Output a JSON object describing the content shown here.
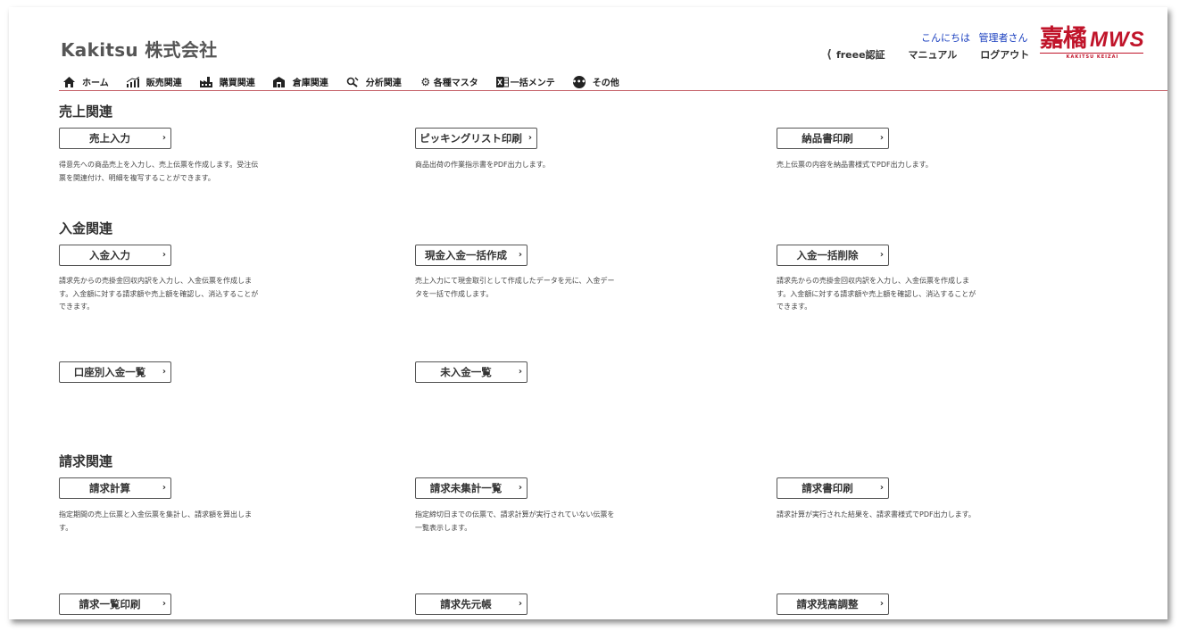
{
  "header": {
    "company": "Kakitsu 株式会社",
    "greeting_prefix": "こんにちは",
    "user_name": "管理者さん",
    "links": {
      "freee": "freee認証",
      "manual": "マニュアル",
      "logout": "ログアウト"
    },
    "logo": {
      "kanji": "嘉橘",
      "mws": "MWS",
      "sub": "KAKITSU KEIZAI"
    }
  },
  "nav": {
    "home": "ホーム",
    "sales": "販売関連",
    "purchase": "購買関連",
    "warehouse": "倉庫関連",
    "analysis": "分析関連",
    "master": "各種マスタ",
    "bulk": "一括メンテ",
    "other": "その他"
  },
  "sections": {
    "sales": {
      "title": "売上関連",
      "b1": {
        "label": "売上入力",
        "desc": "得意先への商品売上を入力し、売上伝票を作成します。受注伝票を関連付け、明細を複写することができます。"
      },
      "b2": {
        "label": "ピッキングリスト印刷",
        "desc": "商品出荷の作業指示書をPDF出力します。"
      },
      "b3": {
        "label": "納品書印刷",
        "desc": "売上伝票の内容を納品書様式でPDF出力します。"
      }
    },
    "payment": {
      "title": "入金関連",
      "b1": {
        "label": "入金入力",
        "desc": "請求先からの売掛金回収内訳を入力し、入金伝票を作成します。入金額に対する請求額や売上額を確認し、消込することができます。"
      },
      "b2": {
        "label": "現金入金一括作成",
        "desc": "売上入力にて現金取引として作成したデータを元に、入金データを一括で作成します。"
      },
      "b3": {
        "label": "入金一括削除",
        "desc": "請求先からの売掛金回収内訳を入力し、入金伝票を作成します。入金額に対する請求額や売上額を確認し、消込することができます。"
      },
      "b4": {
        "label": "口座別入金一覧"
      },
      "b5": {
        "label": "未入金一覧"
      }
    },
    "billing": {
      "title": "請求関連",
      "b1": {
        "label": "請求計算",
        "desc": "指定期間の売上伝票と入金伝票を集計し、請求額を算出します。"
      },
      "b2": {
        "label": "請求未集計一覧",
        "desc": "指定締切日までの伝票で、請求計算が実行されていない伝票を一覧表示します。"
      },
      "b3": {
        "label": "請求書印刷",
        "desc": "請求計算が実行された結果を、請求書様式でPDF出力します。"
      },
      "b4": {
        "label": "請求一覧印刷"
      },
      "b5": {
        "label": "請求先元帳"
      },
      "b6": {
        "label": "請求残高調整"
      }
    }
  }
}
